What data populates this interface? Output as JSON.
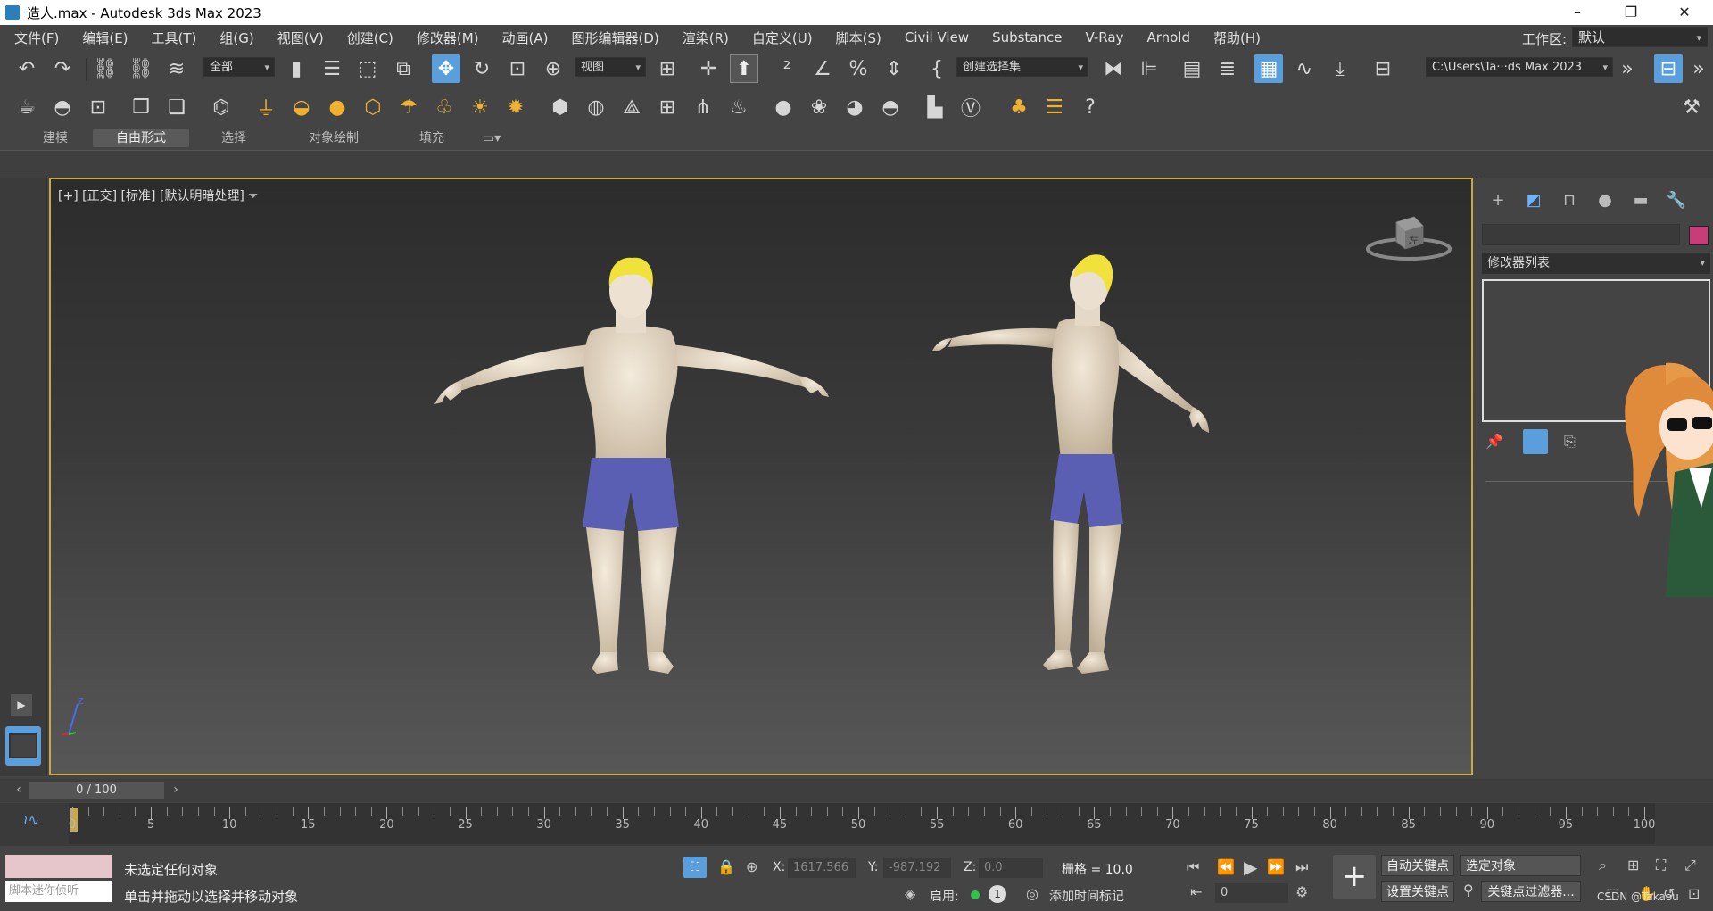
{
  "window": {
    "title": "造人.max - Autodesk 3ds Max 2023",
    "controls": [
      "–",
      "❐",
      "✕"
    ]
  },
  "menu": {
    "items": [
      "文件(F)",
      "编辑(E)",
      "工具(T)",
      "组(G)",
      "视图(V)",
      "创建(C)",
      "修改器(M)",
      "动画(A)",
      "图形编辑器(D)",
      "渲染(R)",
      "自定义(U)",
      "脚本(S)",
      "Civil View",
      "Substance",
      "V-Ray",
      "Arnold",
      "帮助(H)"
    ],
    "workspace_label": "工作区:",
    "workspace_value": "默认"
  },
  "toolbar": {
    "selection_filter": "全部",
    "ref_coord": "视图",
    "named_selection": "创建选择集",
    "project_path": "C:\\Users\\Ta···ds Max 2023"
  },
  "ribbon": {
    "tabs": [
      "建模",
      "自由形式",
      "选择",
      "对象绘制",
      "填充"
    ],
    "active_tab": "自由形式"
  },
  "viewport": {
    "label": "[+] [正交] [标准] [默认明暗处理]",
    "viewcube_face": "左",
    "axis_label": "Z"
  },
  "command_panel": {
    "modifier_list": "修改器列表",
    "accent_color": "#c83c78"
  },
  "time": {
    "current": "0 / 100",
    "ticks": [
      "0",
      "5",
      "10",
      "15",
      "20",
      "25",
      "30",
      "35",
      "40",
      "45",
      "50",
      "55",
      "60",
      "65",
      "70",
      "75",
      "80",
      "85",
      "90",
      "95",
      "100"
    ]
  },
  "status": {
    "maxscript_placeholder": "脚本迷你侦听",
    "line1": "未选定任何对象",
    "line2": "单击并拖动以选择并移动对象",
    "x_label": "X:",
    "x_value": "1617.566",
    "y_label": "Y:",
    "y_value": "-987.192",
    "z_label": "Z:",
    "z_value": "0.0",
    "grid": "栅格 = 10.0",
    "enable_label": "启用:",
    "add_time_tag": "添加时间标记",
    "auto_key": "自动关键点",
    "set_key": "设置关键点",
    "key_target": "选定对象",
    "key_filters": "关键点过滤器...",
    "frame_value": "0",
    "watermark": "CSDN @Takaou"
  }
}
